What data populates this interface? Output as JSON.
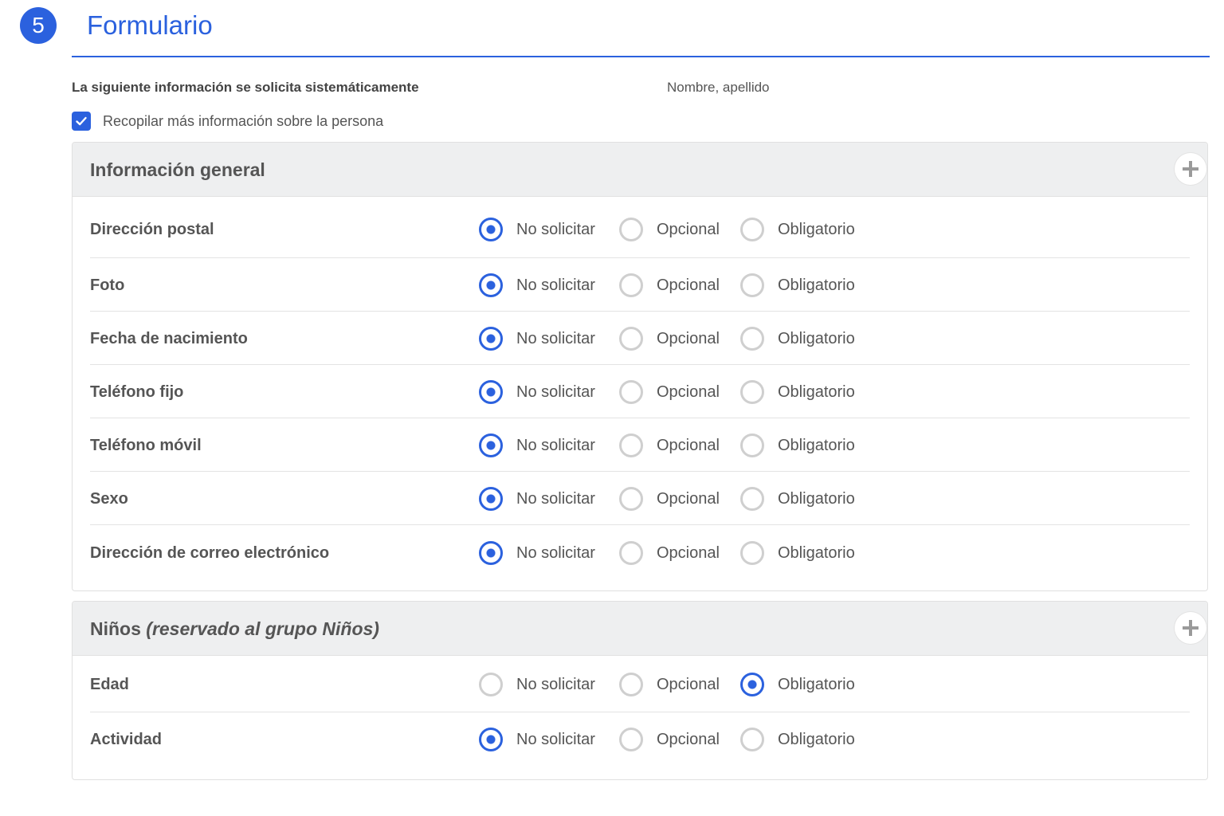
{
  "step": {
    "number": "5",
    "title": "Formulario"
  },
  "systematic_info": {
    "label": "La siguiente información se solicita sistemáticamente",
    "value": "Nombre, apellido"
  },
  "collect_more": {
    "label": "Recopilar más información sobre la persona",
    "checked": true
  },
  "options": [
    "No solicitar",
    "Opcional",
    "Obligatorio"
  ],
  "colors": {
    "accent": "#2b61de",
    "radio_off": "#cfcfcf",
    "panel_header_bg": "#eeeff0"
  },
  "icons": {
    "checkbox": "checkmark-icon",
    "add": "plus-icon"
  },
  "general_section": {
    "title": "Información general",
    "fields": [
      {
        "label": "Dirección postal",
        "selected": "No solicitar"
      },
      {
        "label": "Foto",
        "selected": "No solicitar"
      },
      {
        "label": "Fecha de nacimiento",
        "selected": "No solicitar"
      },
      {
        "label": "Teléfono fijo",
        "selected": "No solicitar"
      },
      {
        "label": "Teléfono móvil",
        "selected": "No solicitar"
      },
      {
        "label": "Sexo",
        "selected": "No solicitar"
      },
      {
        "label": "Dirección de correo electrónico",
        "selected": "No solicitar"
      }
    ]
  },
  "children_section": {
    "title": "Niños",
    "subtitle": "(reservado al grupo Niños)",
    "fields": [
      {
        "label": "Edad",
        "selected": "Obligatorio"
      },
      {
        "label": "Actividad",
        "selected": "No solicitar"
      }
    ]
  }
}
